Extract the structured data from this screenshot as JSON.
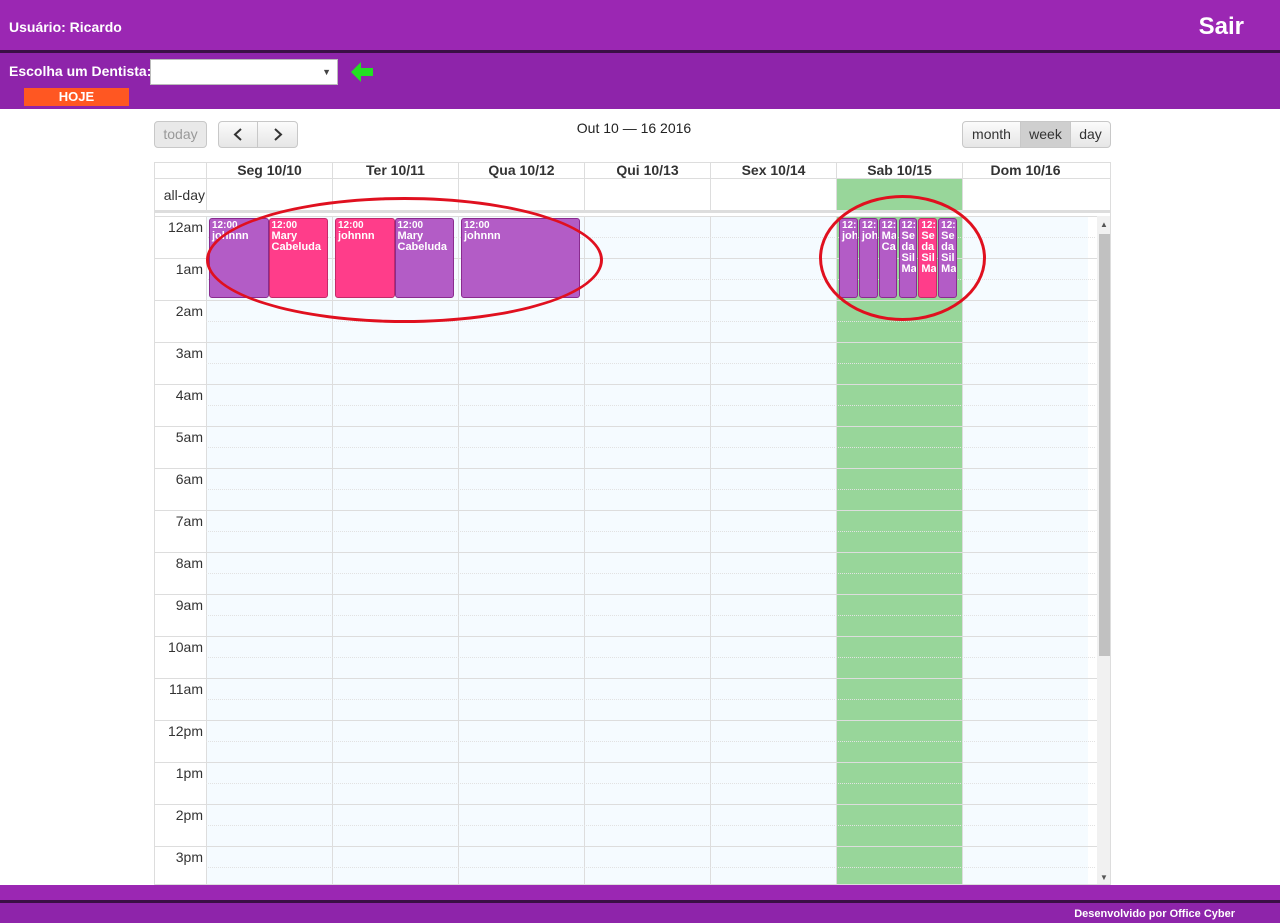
{
  "header": {
    "user_label": "Usuário: Ricardo",
    "logout_label": "Sair"
  },
  "subheader": {
    "dentist_label": "Escolha um Dentista:",
    "dentist_value": "",
    "today_label": "HOJE"
  },
  "calendar": {
    "title": "Out 10 — 16 2016",
    "today_label": "today",
    "prev_label": "‹",
    "next_label": "›",
    "views": [
      "month",
      "week",
      "day"
    ],
    "active_view": "week",
    "allday_label": "all-day",
    "days": [
      "Seg 10/10",
      "Ter 10/11",
      "Qua 10/12",
      "Qui 10/13",
      "Sex 10/14",
      "Sab 10/15",
      "Dom 10/16"
    ],
    "today_index": 5,
    "time_labels": [
      "12am",
      "1am",
      "2am",
      "3am",
      "4am",
      "5am",
      "6am",
      "7am",
      "8am",
      "9am",
      "10am",
      "11am",
      "12pm",
      "1pm",
      "2pm",
      "3pm"
    ],
    "events": [
      {
        "day": 0,
        "col": 0,
        "cols": 2,
        "time": "12:00",
        "title": "johnnn",
        "color": "purple"
      },
      {
        "day": 0,
        "col": 1,
        "cols": 2,
        "time": "12:00",
        "title": "Mary Cabeluda",
        "color": "pink"
      },
      {
        "day": 1,
        "col": 0,
        "cols": 2,
        "time": "",
        "title": "",
        "color": "pink"
      },
      {
        "day": 1,
        "col": 0,
        "cols": 2,
        "time": "12:00",
        "title": "johnnn",
        "color": "pink"
      },
      {
        "day": 1,
        "col": 1,
        "cols": 2,
        "time": "12:00",
        "title": "Mary Cabeluda",
        "color": "purple"
      },
      {
        "day": 2,
        "col": 0,
        "cols": 1,
        "time": "12:00",
        "title": "johnnn",
        "color": "purple"
      },
      {
        "day": 5,
        "col": 0,
        "cols": 6,
        "time": "12:",
        "title": "joh",
        "color": "purple"
      },
      {
        "day": 5,
        "col": 1,
        "cols": 6,
        "time": "12:",
        "title": "joh",
        "color": "purple"
      },
      {
        "day": 5,
        "col": 2,
        "cols": 6,
        "time": "12:",
        "title": "Ma Ca",
        "color": "purple"
      },
      {
        "day": 5,
        "col": 3,
        "cols": 6,
        "time": "12:",
        "title": "Se da Sil Ma",
        "color": "purple"
      },
      {
        "day": 5,
        "col": 4,
        "cols": 6,
        "time": "12:",
        "title": "Se da Sil Ma",
        "color": "pink"
      },
      {
        "day": 5,
        "col": 5,
        "cols": 6,
        "time": "12:",
        "title": "Se da Sil Ma",
        "color": "purple"
      }
    ]
  },
  "footer": {
    "credit": "Desenvolvido por Office Cyber"
  },
  "colors": {
    "header_purple": "#9b27b3",
    "event_purple": "#b35cc6",
    "event_pink": "#ff3d8a",
    "today_green": "#98d69a",
    "hoje_orange": "#ff5722",
    "arrow_green": "#22e022"
  }
}
